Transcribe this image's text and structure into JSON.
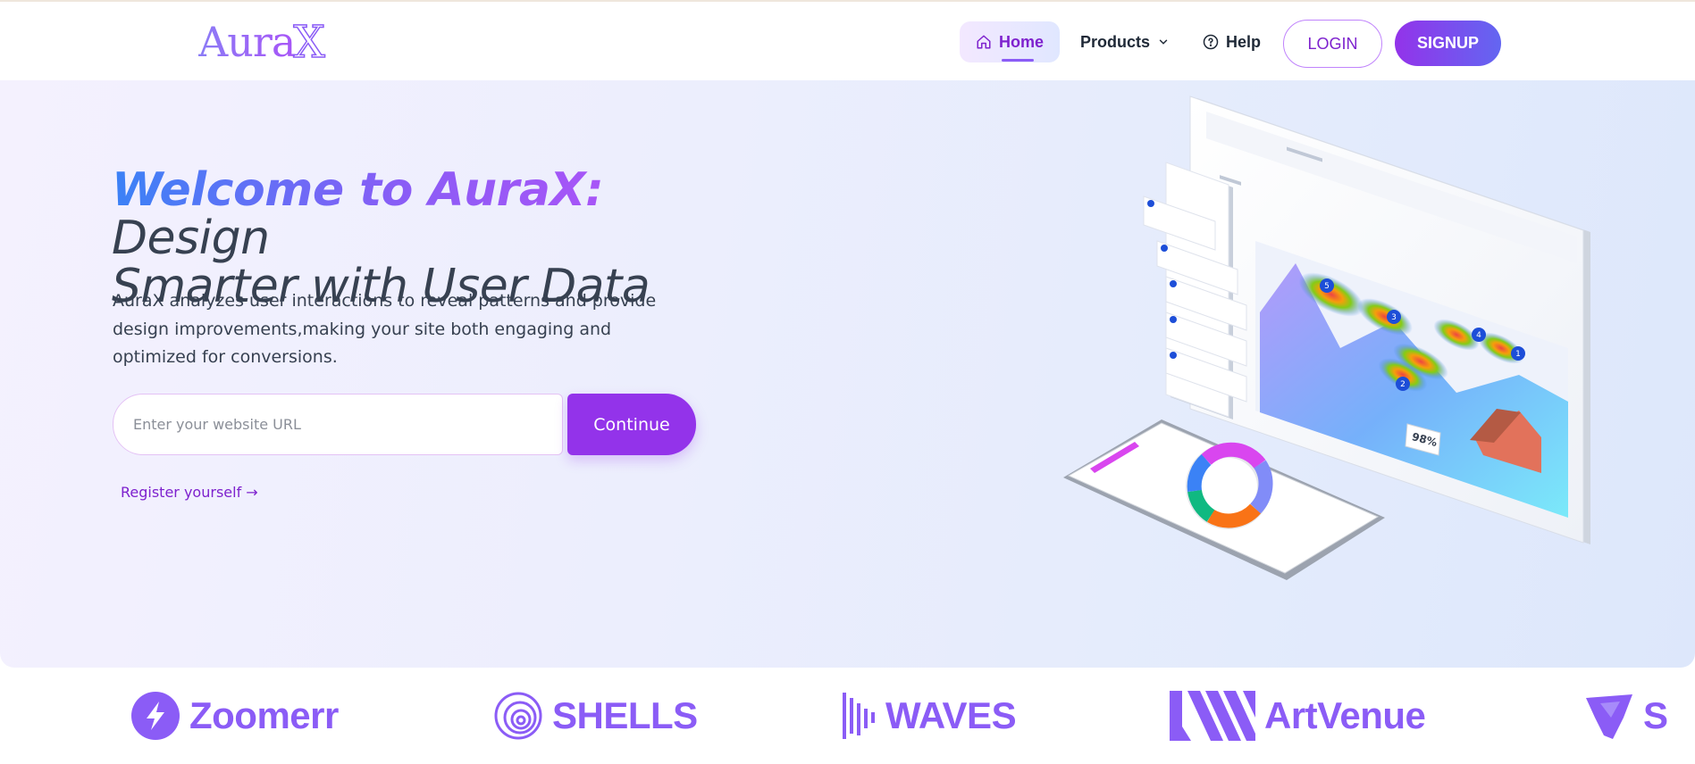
{
  "header": {
    "logo_text": "Aura",
    "logo_x": "X",
    "nav": {
      "home": "Home",
      "products": "Products",
      "help": "Help"
    },
    "login": "LOGIN",
    "signup": "SIGNUP"
  },
  "hero": {
    "headline_accent": "Welcome to AuraX:",
    "headline_rest_1": "Design",
    "headline_rest_2": "Smarter with User Data",
    "description": "AuraX analyzes user interactions to reveal patterns and provide design improvements,making your site both engaging and optimized for conversions.",
    "url_placeholder": "Enter your website URL",
    "continue": "Continue",
    "register": "Register yourself →"
  },
  "illustration": {
    "percent_badge": "98%",
    "heatmap_markers": [
      "5",
      "3",
      "4",
      "1",
      "2"
    ]
  },
  "brands": [
    {
      "name": "Zoomerr",
      "icon": "bolt-circle-icon"
    },
    {
      "name": "SHELLS",
      "icon": "spiral-shell-icon"
    },
    {
      "name": "WAVES",
      "icon": "sound-bars-icon"
    },
    {
      "name": "ArtVenue",
      "icon": "stripes-n-icon"
    },
    {
      "name": "S",
      "icon": "fox-head-icon"
    }
  ],
  "colors": {
    "primary": "#9333ea",
    "accent_blue": "#3b82f6",
    "brand_purple": "#8b5cf6"
  }
}
